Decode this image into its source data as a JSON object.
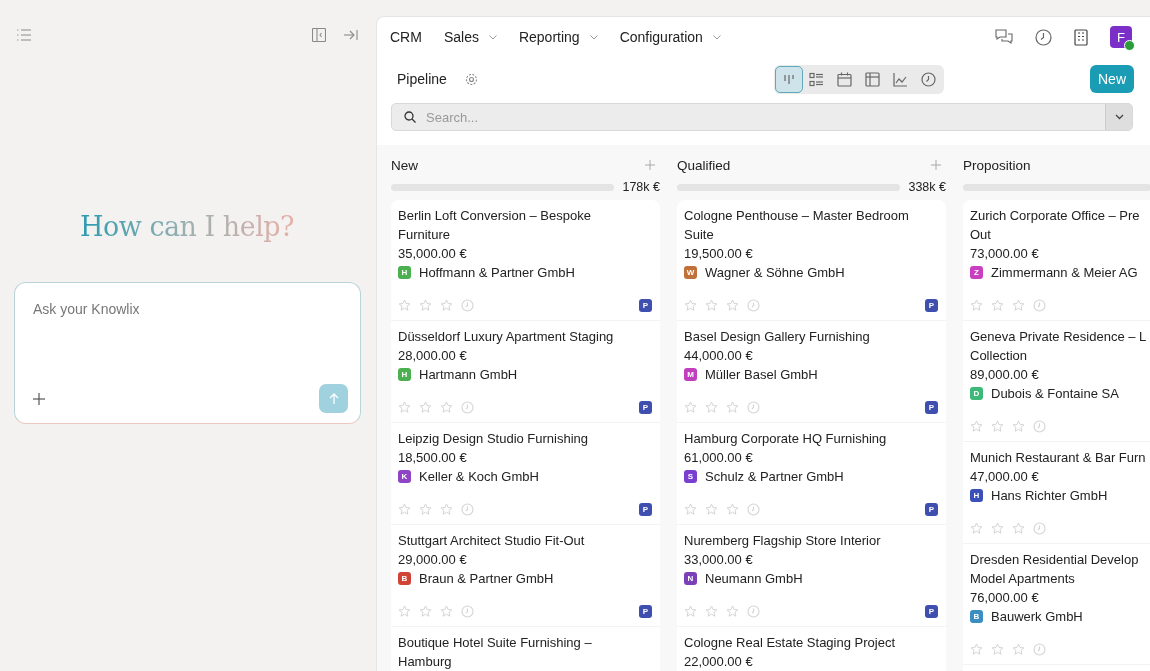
{
  "assistant": {
    "heading": "How can I help?",
    "input": {
      "placeholder": "Ask your Knowlix"
    }
  },
  "nav": {
    "items": [
      {
        "label": "CRM",
        "dropdown": false
      },
      {
        "label": "Sales",
        "dropdown": true
      },
      {
        "label": "Reporting",
        "dropdown": true
      },
      {
        "label": "Configuration",
        "dropdown": true
      }
    ],
    "avatar": {
      "initial": "F",
      "online": true
    }
  },
  "toolbar": {
    "title": "Pipeline",
    "views": [
      {
        "kind": "kanban",
        "selected": true
      },
      {
        "kind": "list",
        "selected": false
      },
      {
        "kind": "calendar",
        "selected": false
      },
      {
        "kind": "pivot",
        "selected": false
      },
      {
        "kind": "graph",
        "selected": false
      },
      {
        "kind": "activity",
        "selected": false
      }
    ],
    "new_button": "New"
  },
  "search": {
    "placeholder": "Search..."
  },
  "columns": [
    {
      "name": "New",
      "total": "178k €",
      "addable": true,
      "level": 0,
      "cards": [
        {
          "title_lines": [
            "Berlin Loft Conversion – Bespoke",
            "Furniture"
          ],
          "amount": "35,000.00 €",
          "company": "Hoffmann & Partner GmbH",
          "initial": "H",
          "color": "#4caf50",
          "stars": 0,
          "owner": "P"
        },
        {
          "title_lines": [
            "Düsseldorf Luxury Apartment Staging"
          ],
          "amount": "28,000.00 €",
          "company": "Hartmann GmbH",
          "initial": "H",
          "color": "#4caf50",
          "stars": 0,
          "owner": "P"
        },
        {
          "title_lines": [
            "Leipzig Design Studio Furnishing"
          ],
          "amount": "18,500.00 €",
          "company": "Keller & Koch GmbH",
          "initial": "K",
          "color": "#8e44c4",
          "stars": 0,
          "owner": "P"
        },
        {
          "title_lines": [
            "Stuttgart Architect Studio Fit-Out"
          ],
          "amount": "29,000.00 €",
          "company": "Braun & Partner GmbH",
          "initial": "B",
          "color": "#d04437",
          "stars": 0,
          "owner": "P"
        },
        {
          "title_lines": [
            "Boutique Hotel Suite Furnishing –",
            "Hamburg"
          ]
        }
      ]
    },
    {
      "name": "Qualified",
      "total": "338k €",
      "addable": true,
      "level": 0,
      "cards": [
        {
          "title_lines": [
            "Cologne Penthouse – Master Bedroom",
            "Suite"
          ],
          "amount": "19,500.00 €",
          "company": "Wagner & Söhne GmbH",
          "initial": "W",
          "color": "#c0703a",
          "stars": 0,
          "owner": "P"
        },
        {
          "title_lines": [
            "Basel Design Gallery Furnishing"
          ],
          "amount": "44,000.00 €",
          "company": "Müller Basel GmbH",
          "initial": "M",
          "color": "#c13fbf",
          "stars": 0,
          "owner": "P"
        },
        {
          "title_lines": [
            "Hamburg Corporate HQ Furnishing"
          ],
          "amount": "61,000.00 €",
          "company": "Schulz & Partner GmbH",
          "initial": "S",
          "color": "#7b3fd0",
          "stars": 0,
          "owner": "P"
        },
        {
          "title_lines": [
            "Nuremberg Flagship Store Interior"
          ],
          "amount": "33,000.00 €",
          "company": "Neumann GmbH",
          "initial": "N",
          "color": "#7b3fb8",
          "stars": 0,
          "owner": "P"
        },
        {
          "title_lines": [
            "Cologne Real Estate Staging Project"
          ],
          "amount": "22,000.00 €"
        }
      ]
    },
    {
      "name": "Proposition",
      "addable": false,
      "level": 0,
      "cards": [
        {
          "title_lines": [
            "Zurich Corporate Office – Pre",
            "Out"
          ],
          "amount": "73,000.00 €",
          "company": "Zimmermann & Meier AG",
          "initial": "Z",
          "color": "#c83fc0",
          "stars": 0
        },
        {
          "title_lines": [
            "Geneva Private Residence – L",
            "Collection"
          ],
          "amount": "89,000.00 €",
          "company": "Dubois & Fontaine SA",
          "initial": "D",
          "color": "#3cb878",
          "stars": 0
        },
        {
          "title_lines": [
            "Munich Restaurant & Bar Furn"
          ],
          "amount": "47,000.00 €",
          "company": "Hans Richter GmbH",
          "initial": "H",
          "color": "#3b4fb8",
          "stars": 0
        },
        {
          "title_lines": [
            "Dresden Residential Develop",
            "Model Apartments"
          ],
          "amount": "76,000.00 €",
          "company": "Bauwerk GmbH",
          "initial": "B",
          "color": "#3b8fc0",
          "stars": 0
        }
      ]
    }
  ]
}
